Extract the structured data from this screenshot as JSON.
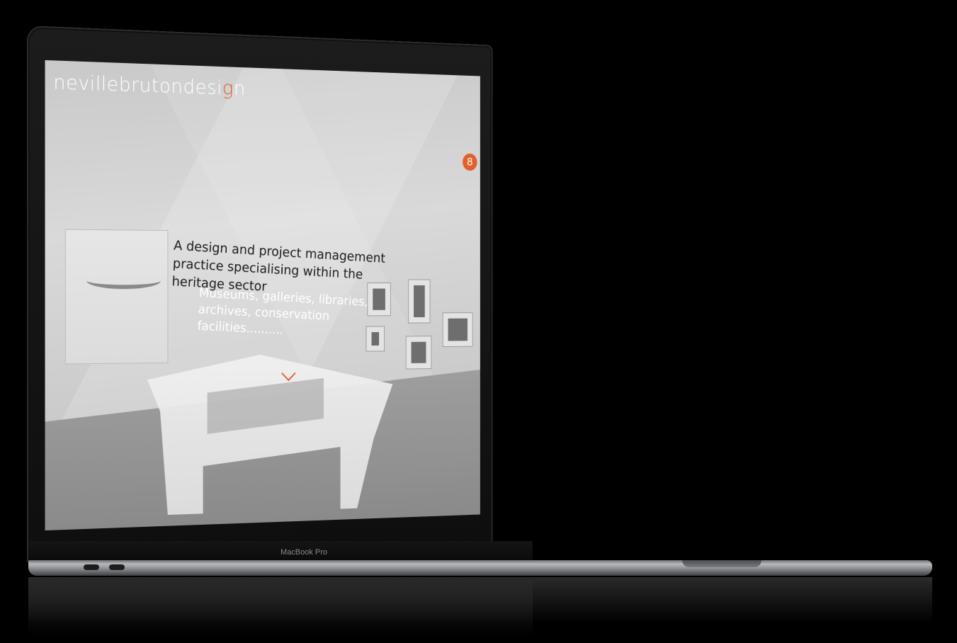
{
  "site": {
    "logo_text": "nevillebrutondesi",
    "logo_accent": "g",
    "logo_end": "n",
    "badge_glyph": "8",
    "headline": "A design and project management practice specialising within the heritage sector",
    "subline": "Museums, galleries, libraries, archives, conservation facilities..........",
    "scroll_icon": "chevron-down-icon"
  },
  "device": {
    "brand_label": "MacBook Pro"
  },
  "colors": {
    "accent": "#e35f2c",
    "screen_bg": "#cfcfcf",
    "body": "#000000"
  }
}
